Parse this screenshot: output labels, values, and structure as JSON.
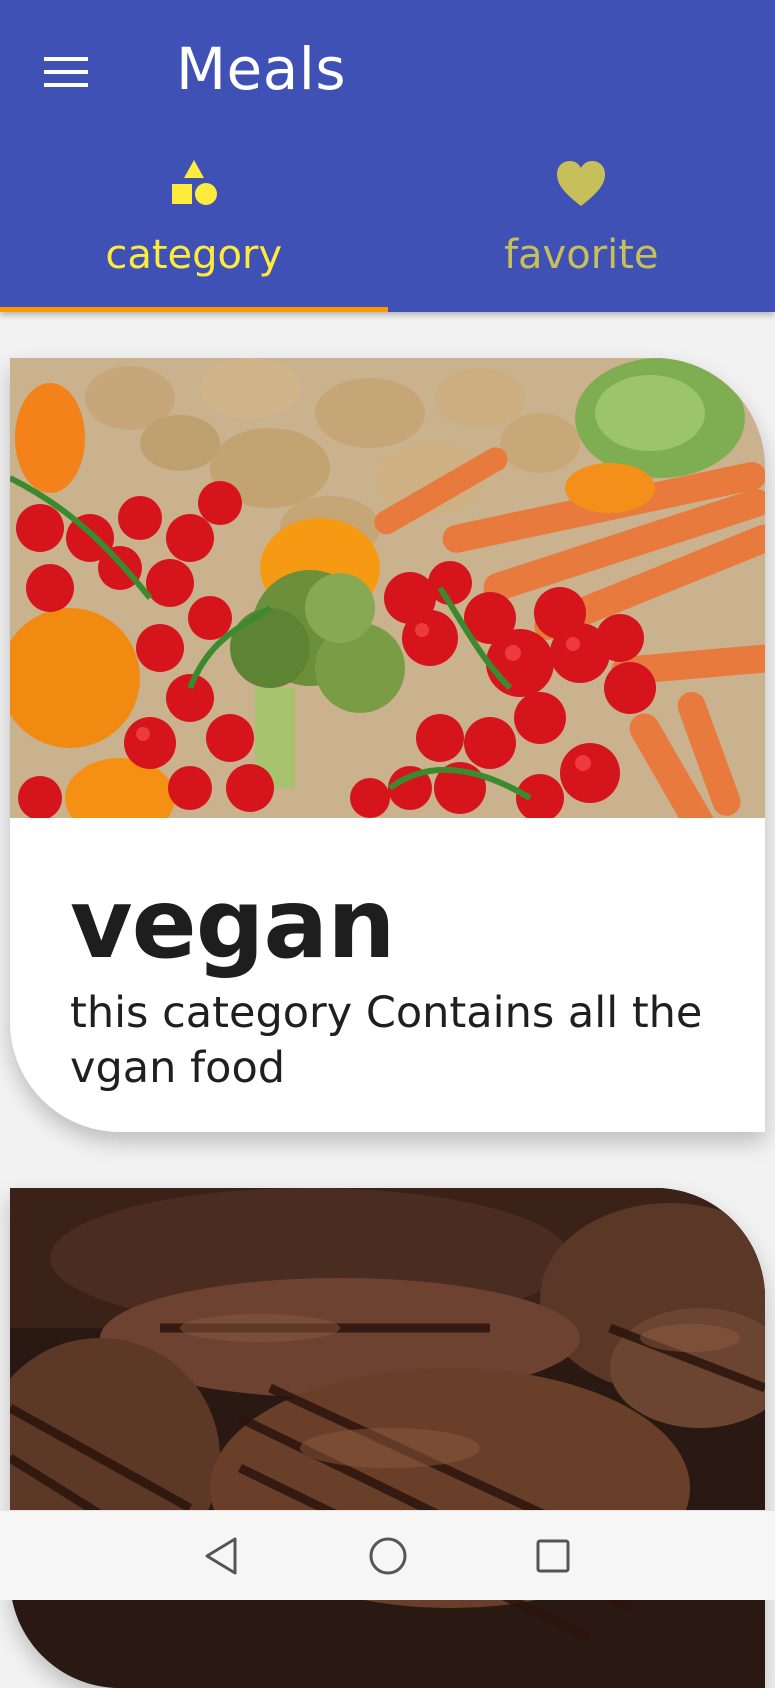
{
  "appbar": {
    "title": "Meals",
    "menu_icon": "hamburger-menu-icon",
    "background": "#3f51b5"
  },
  "tabs": [
    {
      "label": "category",
      "icon": "shapes-icon",
      "active": true,
      "color": "#ffeb3b"
    },
    {
      "label": "favorite",
      "icon": "heart-icon",
      "active": false,
      "color": "#c7bf5a"
    }
  ],
  "indicator_color": "#ff9800",
  "categories": [
    {
      "title": "vegan",
      "description": "this category Contains all the vgan food",
      "image": "vegetables-photo"
    },
    {
      "title": "",
      "description": "",
      "image": "grilled-burgers-photo"
    }
  ],
  "system_nav": {
    "back_icon": "back-triangle-icon",
    "home_icon": "home-circle-icon",
    "recents_icon": "recents-square-icon"
  }
}
